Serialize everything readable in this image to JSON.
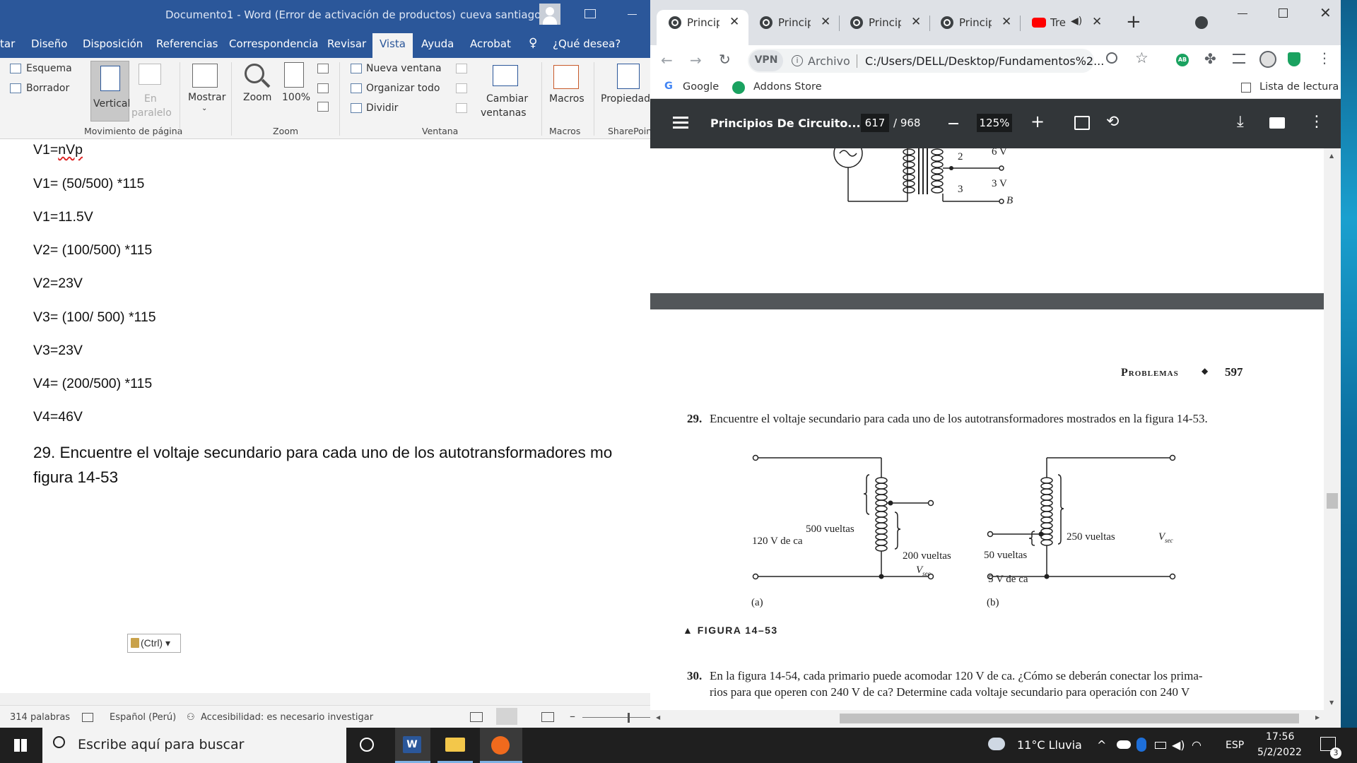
{
  "word": {
    "title": "Documento1  -  Word (Error de activación de productos)",
    "user": "cueva santiago",
    "tabs": [
      "tar",
      "Diseño",
      "Disposición",
      "Referencias",
      "Correspondencia",
      "Revisar",
      "Vista",
      "Ayuda",
      "Acrobat",
      "¿Qué desea?"
    ],
    "ribbon": {
      "esquema": "Esquema",
      "borrador": "Borrador",
      "vertical": "Vertical",
      "en": "En",
      "paralelo": "paralelo",
      "movimiento": "Movimiento de página",
      "mostrar": "Mostrar",
      "zoom": "Zoom",
      "pct": "100%",
      "zoom_group": "Zoom",
      "nueva": "Nueva ventana",
      "organizar": "Organizar todo",
      "dividir": "Dividir",
      "cambiar1": "Cambiar",
      "cambiar2": "ventanas",
      "ventana_group": "Ventana",
      "macros": "Macros",
      "macros_group": "Macros",
      "propiedad": "Propiedad",
      "sharepoint": "SharePoint"
    },
    "lines": [
      "V1=nVp",
      "V1= (50/500) *115",
      "V1=11.5V",
      "V2= (100/500) *115",
      "V2=23V",
      "V3= (100/ 500) *115",
      "V3=23V",
      "V4= (200/500) *115",
      "V4=46V"
    ],
    "q29_line1": "29. Encuentre el voltaje secundario para cada uno de los autotransformadores mo",
    "q29_line2": "figura 14-53",
    "ctrl": "(Ctrl)",
    "status": {
      "words": "314 palabras",
      "lang": "Español (Perú)",
      "access": "Accesibilidad: es necesario investigar"
    }
  },
  "chrome": {
    "tab_labels": [
      "Princip",
      "Princip",
      "Princip",
      "Princip",
      "Tre"
    ],
    "archivo": "Archivo",
    "url": "C:/Users/DELL/Desktop/Fundamentos%2...",
    "vpn": "VPN",
    "ab": "AB",
    "google": "Google",
    "addons": "Addons Store",
    "reading_list": "Lista de lectura",
    "pdf_title": "Principios De Circuito...",
    "page_current": "617",
    "page_total": "/ 968",
    "zoom": "125%"
  },
  "pdf": {
    "top_labels": {
      "n2": "2",
      "v6": "6 V",
      "n3": "3",
      "v3": "3 V",
      "b": "B"
    },
    "header_section": "Problemas",
    "header_page": "597",
    "q29": "29.",
    "q29_text": "Encuentre el voltaje secundario para cada uno de los autotransformadores mostrados en la figura 14-53.",
    "fig_a": {
      "v": "120 V de ca",
      "n1": "500 vueltas",
      "n2": "200 vueltas",
      "vsec": "V",
      "sub": "sec",
      "label": "(a)"
    },
    "fig_b": {
      "n1": "50 vueltas",
      "v": "5 V de ca",
      "n2": "250 vueltas",
      "vsec": "V",
      "sub": "sec",
      "label": "(b)"
    },
    "figure": "▲ FIGURA 14–53",
    "q30": "30.",
    "q30_line1": "En la figura 14-54, cada primario puede acomodar 120 V de ca. ¿Cómo se deberán conectar los prima-",
    "q30_line2": "rios para que operen con 240 V de ca? Determine cada voltaje secundario para operación con 240 V"
  },
  "taskbar": {
    "search": "Escribe aquí para buscar",
    "weather": "11°C  Lluvia",
    "lang": "ESP",
    "time": "17:56",
    "date": "5/2/2022",
    "notif": "3"
  }
}
